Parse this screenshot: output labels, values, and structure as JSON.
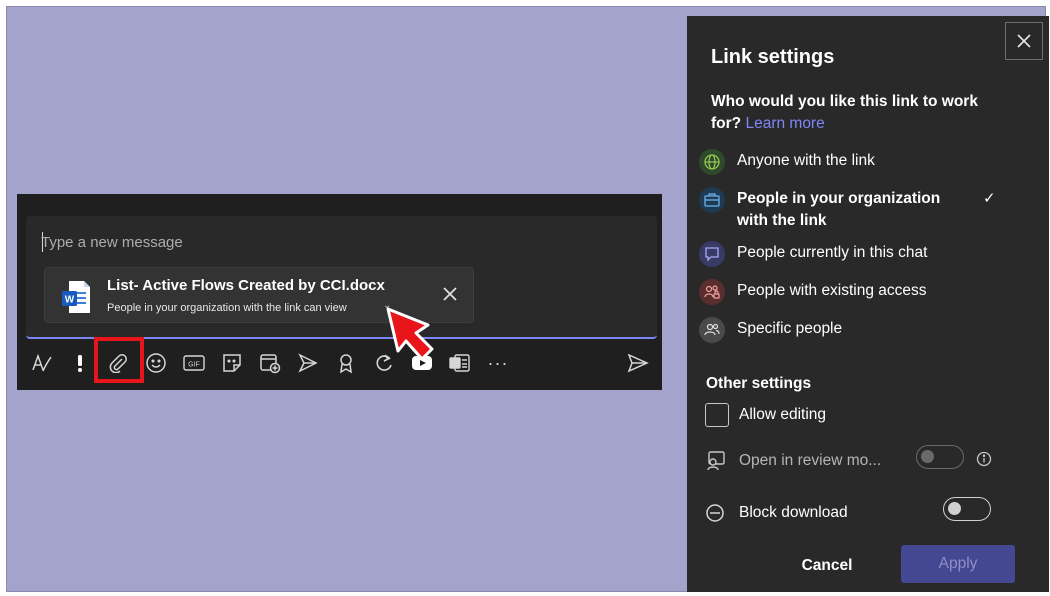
{
  "compose": {
    "placeholder": "Type a new message",
    "attachment": {
      "file_name": "List- Active Flows Created by CCI.docx",
      "permission": "People in your organization with the link can view",
      "file_icon": "word-file-icon"
    },
    "toolbar": [
      {
        "name": "format-icon"
      },
      {
        "name": "important-icon"
      },
      {
        "name": "attach-icon"
      },
      {
        "name": "emoji-icon"
      },
      {
        "name": "gif-icon",
        "label": "GIF"
      },
      {
        "name": "sticker-icon"
      },
      {
        "name": "schedule-meeting-icon"
      },
      {
        "name": "praise-icon"
      },
      {
        "name": "badge-icon"
      },
      {
        "name": "loop-icon"
      },
      {
        "name": "youtube-icon"
      },
      {
        "name": "forms-icon"
      },
      {
        "name": "more-options-icon",
        "label": "···"
      },
      {
        "name": "send-icon"
      }
    ]
  },
  "link_settings": {
    "title": "Link settings",
    "question": "Who would you like this link to work for?",
    "learn_more": "Learn more",
    "options": [
      {
        "label": "Anyone with the link",
        "icon": "globe-icon",
        "color": "#92c353",
        "selected": false
      },
      {
        "label": "People in your organization with the link",
        "icon": "building-icon",
        "color": "#6cb4ee",
        "selected": true
      },
      {
        "label": "People currently in this chat",
        "icon": "chat-icon",
        "color": "#a9a9f5",
        "selected": false
      },
      {
        "label": "People with existing access",
        "icon": "people-lock-icon",
        "color": "#f3a4a4",
        "selected": false
      },
      {
        "label": "Specific people",
        "icon": "people-icon",
        "color": "#d6d6d6",
        "selected": false
      }
    ],
    "other_settings": {
      "title": "Other settings",
      "allow_editing": "Allow editing",
      "open_review": "Open in review mo...",
      "block_download": "Block download"
    },
    "cancel": "Cancel",
    "apply": "Apply"
  },
  "colors": {
    "accent": "#7f85f5",
    "apply_button": "#444791",
    "highlight": "#e8151b",
    "background": "#a3a3cc"
  }
}
